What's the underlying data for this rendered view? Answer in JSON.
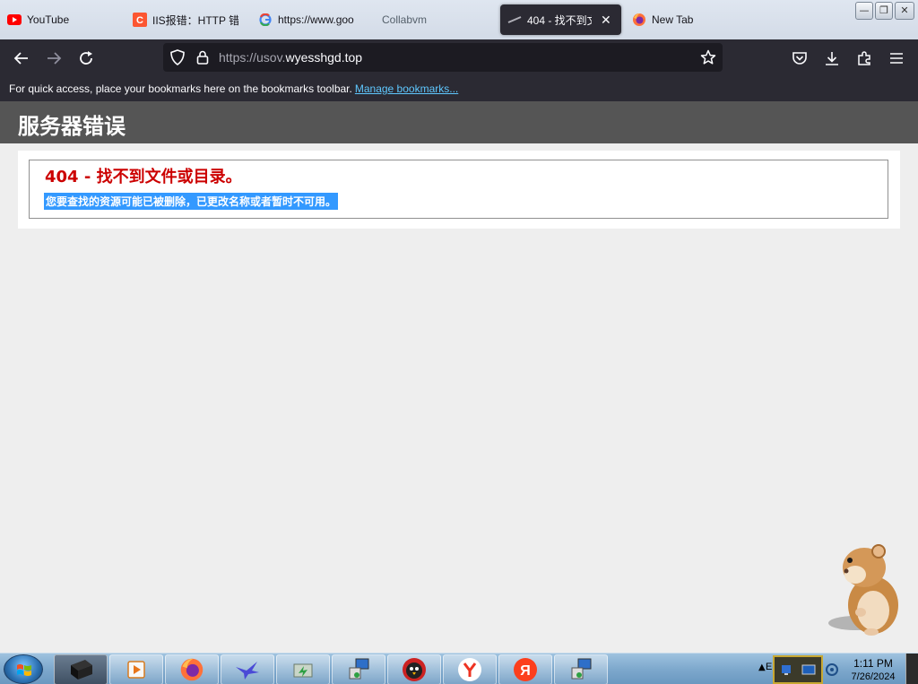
{
  "browser": {
    "tabs": [
      {
        "label": "YouTube",
        "icon": "youtube-icon"
      },
      {
        "label": "IIS报错：HTTP 错",
        "icon": "csdn-icon"
      },
      {
        "label": "https://www.goo",
        "icon": "google-icon"
      },
      {
        "label": "Collabvm",
        "icon": "none"
      },
      {
        "label": "404 - 找不到文",
        "icon": "page-icon",
        "active": true
      },
      {
        "label": "New Tab",
        "icon": "firefox-icon"
      }
    ],
    "tab_close_glyph": "✕",
    "window_buttons": {
      "minimize": "—",
      "maximize": "❐",
      "close": "✕"
    },
    "url": {
      "prefix": "https://usov.",
      "domain": "wyesshgd.top"
    },
    "bookmarks_message": "For quick access, place your bookmarks here on the bookmarks toolbar.",
    "manage_bookmarks": "Manage bookmarks..."
  },
  "page": {
    "header": "服务器错误",
    "error_title": "404 - 找不到文件或目录。",
    "error_description": "您要查找的资源可能已被删除，已更改名称或者暂时不可用。",
    "colors": {
      "header_bg": "#555555",
      "error_title": "#cc0000",
      "selection": "#3399ff"
    }
  },
  "taskbar": {
    "apps": [
      "media-player-icon",
      "firefox-icon",
      "bird-icon",
      "network-icon",
      "setup-icon",
      "bird-avatar-icon",
      "yandex-browser-icon",
      "yandex-icon",
      "setup-icon"
    ],
    "tray_text": "E",
    "clock_time": "1:11 PM",
    "clock_date": "7/26/2024"
  }
}
